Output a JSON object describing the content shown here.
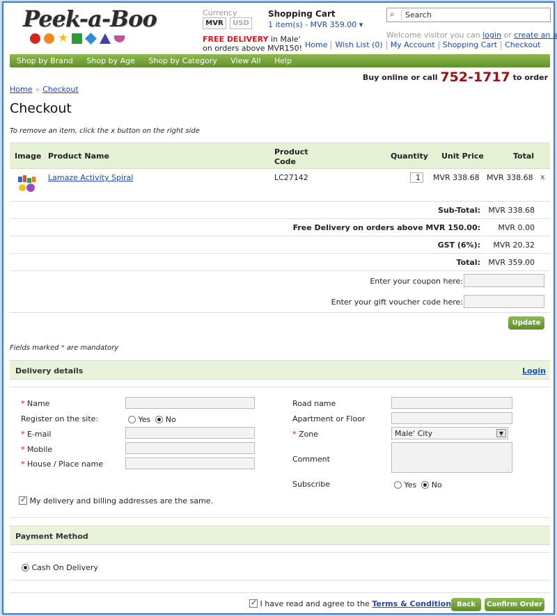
{
  "header": {
    "logo_text": "Peek-a-Boo",
    "currency_label": "Currency",
    "currencies": [
      "MVR",
      "USD"
    ],
    "free_delivery_red": "FREE DELIVERY",
    "free_delivery_rest_1": " in Male'",
    "free_delivery_rest_2": "on orders above MVR150!",
    "cart_title": "Shopping Cart",
    "cart_summary": "1 item(s) - MVR 359.00 ▾",
    "search_placeholder": "Search",
    "welcome_text": "Welcome visitor you can",
    "login_link": "login",
    "or_text": "or",
    "create_account_link": "create an account",
    "links": [
      "Home",
      "Wish List (0)",
      "My Account",
      "Shopping Cart",
      "Checkout"
    ]
  },
  "nav": [
    "Shop by Brand",
    "Shop by Age",
    "Shop by Category",
    "View All",
    "Help"
  ],
  "callus": {
    "prefix": "Buy online or call",
    "phone": "752-1717",
    "suffix": "to order"
  },
  "breadcrumb": [
    "Home",
    "Checkout"
  ],
  "page_title": "Checkout",
  "remove_note": "To remove an item, click the x button on the right side",
  "cart_table": {
    "headers": {
      "image": "Image",
      "name": "Product Name",
      "code_1": "Product",
      "code_2": "Code",
      "qty": "Quantity",
      "unit": "Unit Price",
      "total": "Total"
    },
    "items": [
      {
        "name": "Lamaze Activity Spiral",
        "code": "LC27142",
        "qty": "1",
        "unit_price": "MVR 338.68",
        "total": "MVR 338.68",
        "remove": "x"
      }
    ],
    "totals": [
      {
        "label": "Sub-Total:",
        "value": "MVR 338.68"
      },
      {
        "label": "Free Delivery on orders above MVR 150.00:",
        "value": "MVR 0.00"
      },
      {
        "label": "GST (6%):",
        "value": "MVR 20.32"
      },
      {
        "label": "Total:",
        "value": "MVR 359.00"
      }
    ],
    "coupon_label": "Enter your coupon here:",
    "voucher_label": "Enter your gift voucher code here:",
    "update_button": "Update"
  },
  "mandatory_note_pre": "Fields marked",
  "mandatory_note_star": "*",
  "mandatory_note_post": "are mandatory",
  "delivery": {
    "section_title": "Delivery details",
    "login_link": "Login",
    "name_label": "Name",
    "register_label": "Register on the site:",
    "register_yes": "Yes",
    "register_no": "No",
    "email_label": "E-mail",
    "mobile_label": "Mobile",
    "house_label": "House / Place name",
    "road_label": "Road name",
    "apartment_label": "Apartment or Floor",
    "zone_label": "Zone",
    "zone_value": "Male' City",
    "comment_label": "Comment",
    "subscribe_label": "Subscribe",
    "subscribe_yes": "Yes",
    "subscribe_no": "No",
    "same_address_label": "My delivery and billing addresses are the same."
  },
  "payment": {
    "section_title": "Payment Method",
    "option": "Cash On Delivery"
  },
  "footer": {
    "agree_text": "I have read and agree to the",
    "terms_link": "Terms & Conditions",
    "back_button": "Back",
    "confirm_button": "Confirm Order"
  },
  "colors": {
    "nav_green": "#6f9f35",
    "section_bg": "#e9f3dc",
    "phone_red": "#9b1016",
    "link_blue": "#1f48b3"
  }
}
